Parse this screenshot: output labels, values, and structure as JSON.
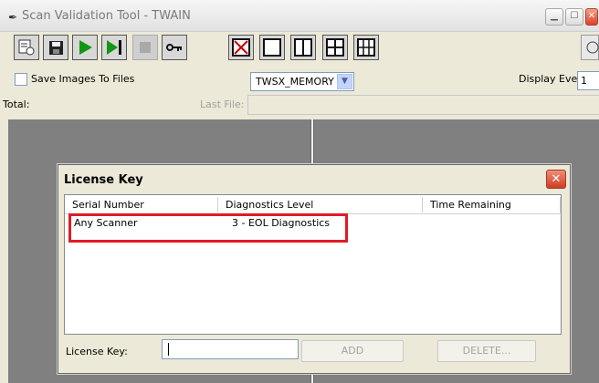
{
  "window": {
    "title": "Scan Validation Tool - TWAIN",
    "title_icon": "pen-icon"
  },
  "toolbar": {
    "buttons": [
      {
        "name": "properties-icon"
      },
      {
        "name": "save-icon"
      },
      {
        "name": "play-icon"
      },
      {
        "name": "step-icon"
      },
      {
        "name": "stop-icon"
      },
      {
        "name": "key-icon"
      },
      {
        "name": "no-view-icon"
      },
      {
        "name": "single-view-icon"
      },
      {
        "name": "dual-view-icon"
      },
      {
        "name": "quad-view-icon"
      },
      {
        "name": "multi-view-icon"
      }
    ]
  },
  "options": {
    "save_images_label": "Save Images To Files",
    "memory_mode": "TWSX_MEMORY",
    "display_every_label": "Display Every:",
    "display_every_value": "1"
  },
  "status": {
    "total_label": "Total:",
    "last_file_label": "Last File:"
  },
  "dialog": {
    "title": "License Key",
    "columns": [
      "Serial Number",
      "Diagnostics Level",
      "Time Remaining"
    ],
    "rows": [
      {
        "serial": "Any Scanner",
        "level": "3 - EOL Diagnostics",
        "time": ""
      }
    ],
    "license_key_label": "License Key:",
    "license_key_value": "",
    "add_label": "ADD",
    "delete_label": "DELETE...",
    "highlight_color": "#e01b24"
  }
}
